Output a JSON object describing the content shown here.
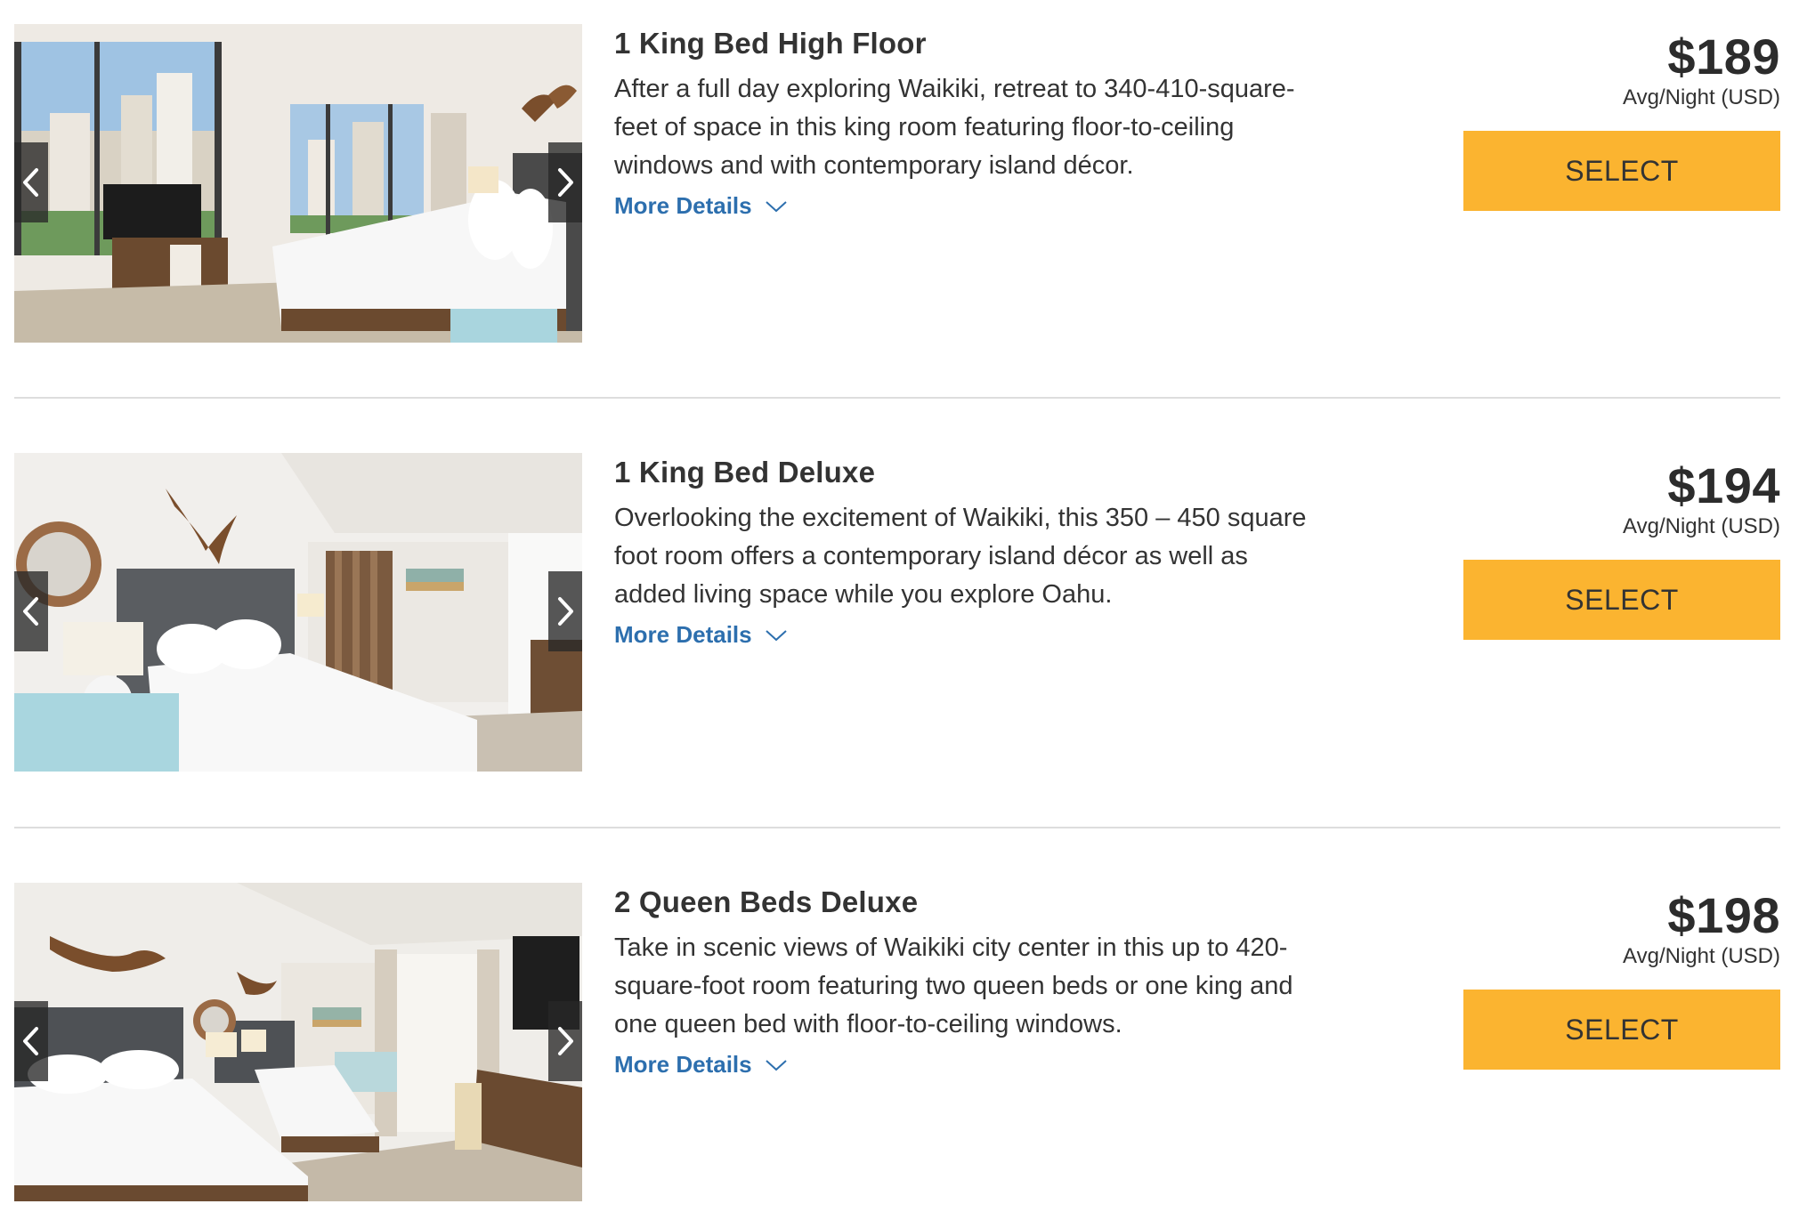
{
  "rooms": [
    {
      "title": "1 King Bed High Floor",
      "description": "After a full day exploring Waikiki, retreat to 340-410-square-feet of space in this king room featuring floor-to-ceiling windows and with contemporary island décor.",
      "more_details_label": "More Details",
      "price": "$189",
      "price_unit": "Avg/Night (USD)",
      "select_label": "SELECT",
      "image_name": "king-high-floor-room-photo"
    },
    {
      "title": "1 King Bed Deluxe",
      "description": "Overlooking the excitement of Waikiki, this 350 – 450 square foot room offers a contemporary island décor as well as added living space while you explore Oahu.",
      "more_details_label": "More Details",
      "price": "$194",
      "price_unit": "Avg/Night (USD)",
      "select_label": "SELECT",
      "image_name": "king-deluxe-room-photo"
    },
    {
      "title": "2 Queen Beds Deluxe",
      "description": "Take in scenic views of Waikiki city center in this up to 420-square-foot room featuring two queen beds or one king and one queen bed with floor-to-ceiling windows.",
      "more_details_label": "More Details",
      "price": "$198",
      "price_unit": "Avg/Night (USD)",
      "select_label": "SELECT",
      "image_name": "queen-deluxe-room-photo"
    }
  ],
  "icons": {
    "prev": "chevron-left-icon",
    "next": "chevron-right-icon",
    "expand": "chevron-down-icon"
  },
  "colors": {
    "select_button": "#fbb430",
    "link": "#2d6fae",
    "text": "#333333",
    "divider": "#dddddd"
  }
}
